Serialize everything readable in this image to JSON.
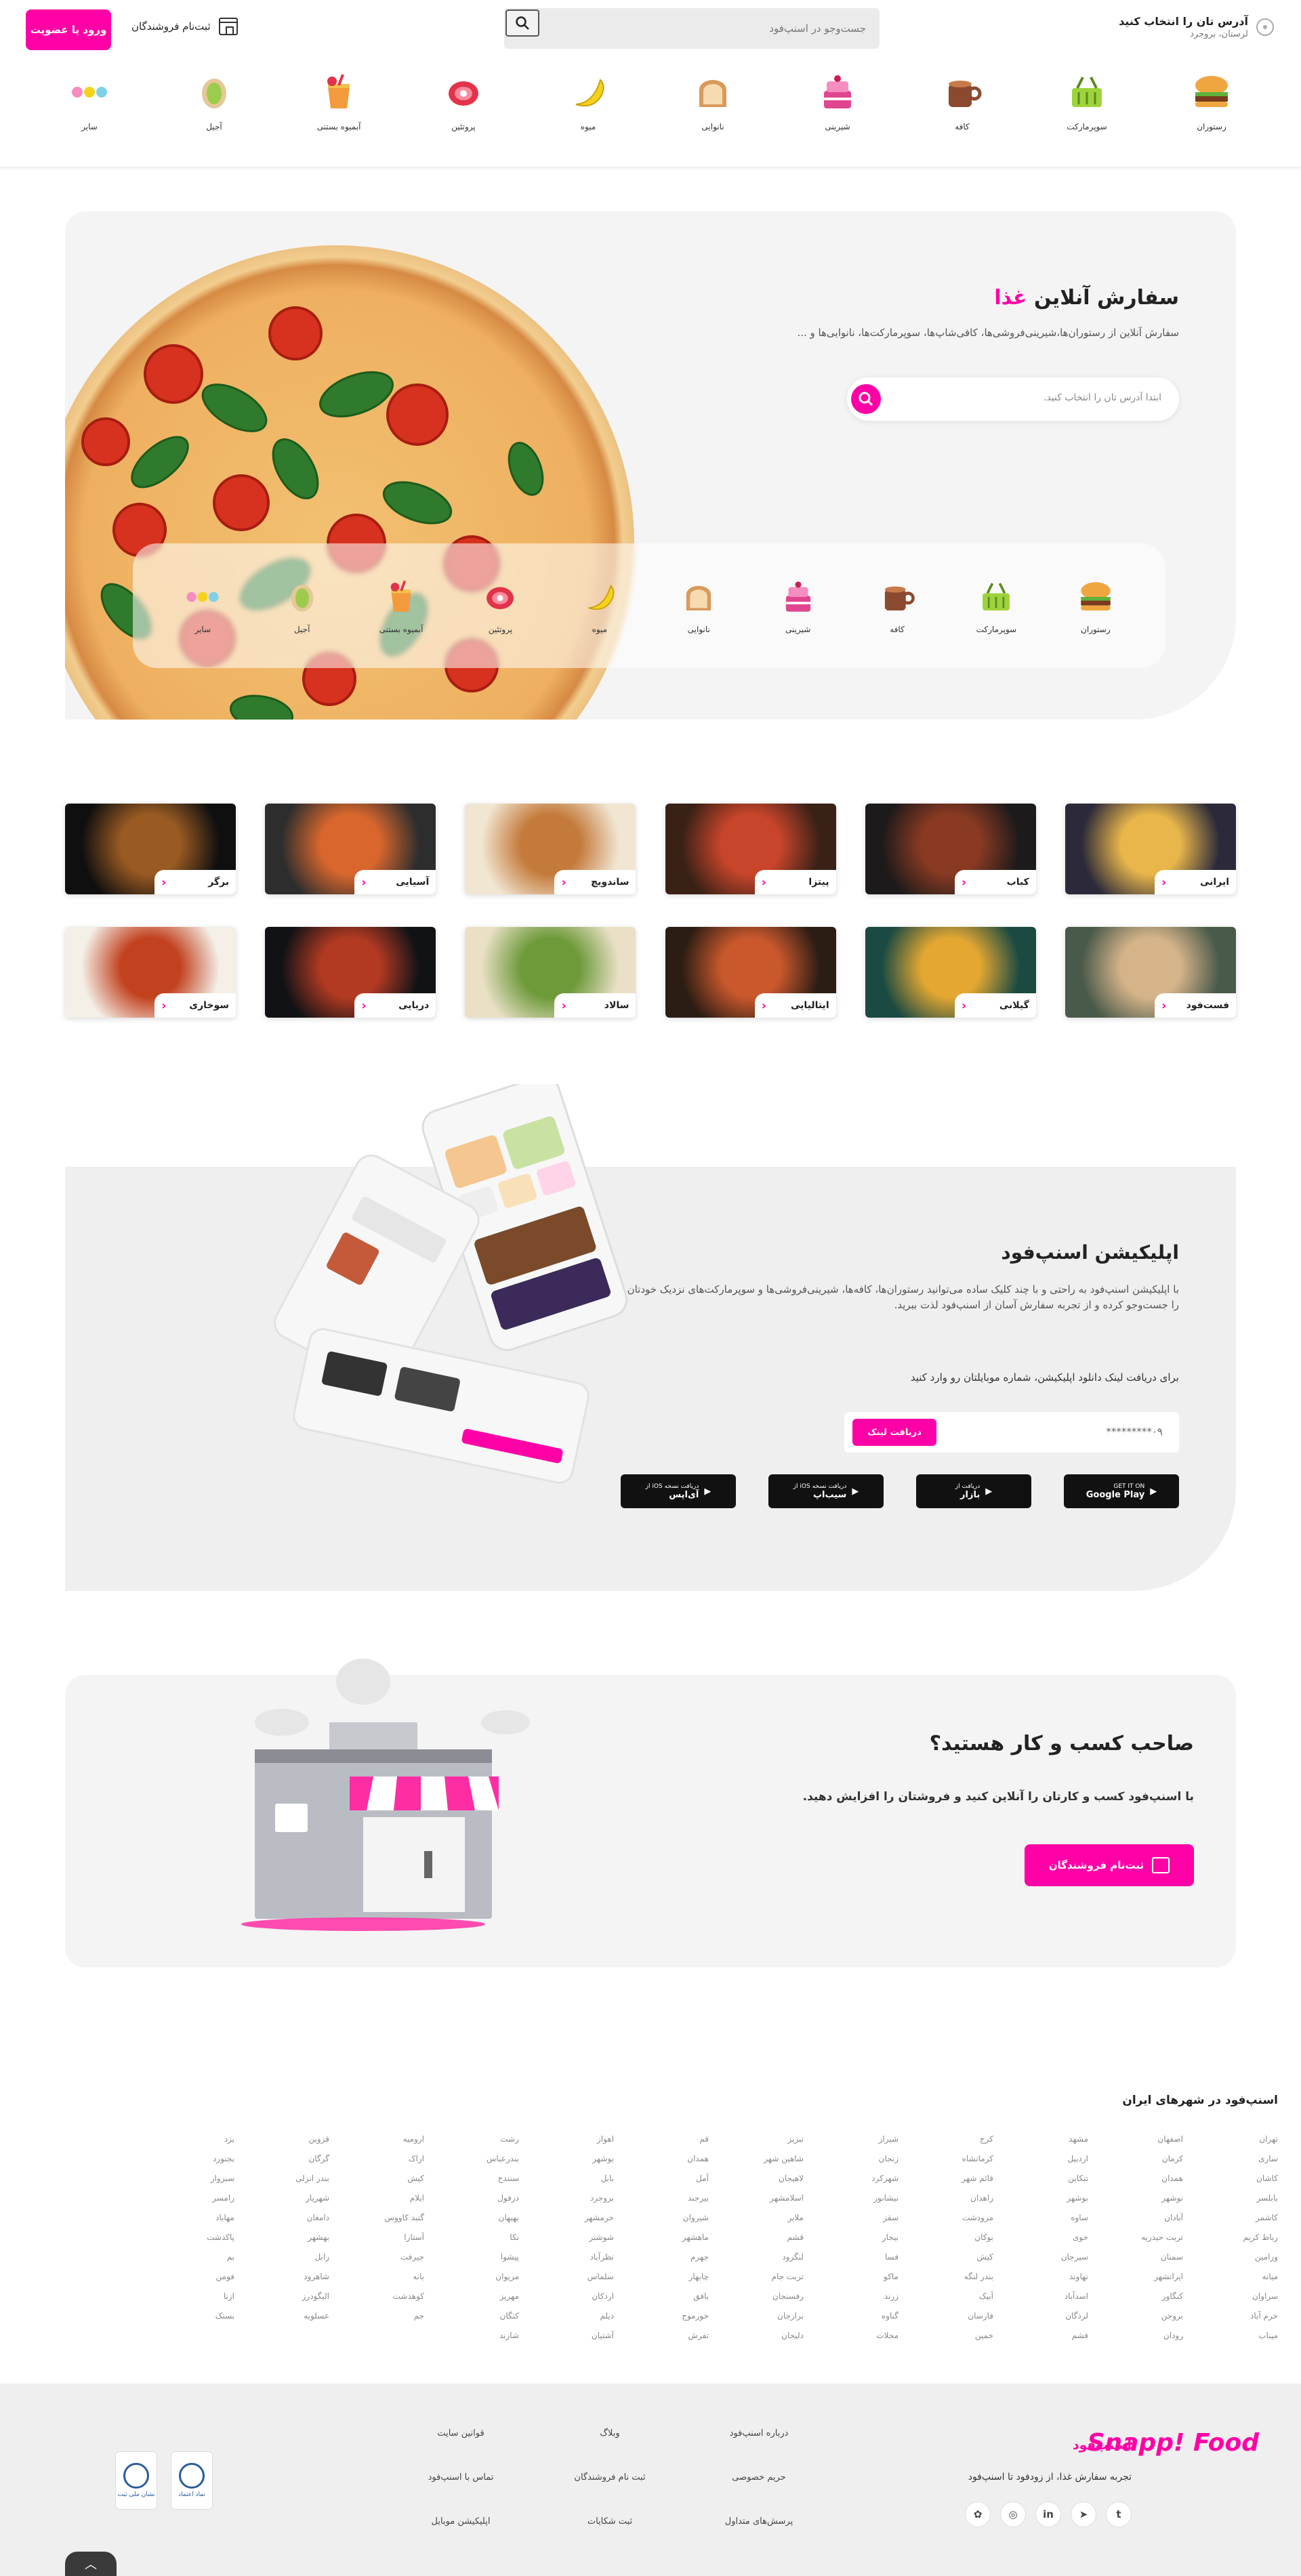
{
  "header": {
    "address_title": "آدرس تان را انتخاب کنید",
    "address_sub": "لرستان، بروجرد",
    "search_placeholder": "جست‌وجو در اسنپ‌فود",
    "login_label": "ورود یا عضویت",
    "vendor_register": "ثبت‌نام فروشندگان"
  },
  "categories": [
    {
      "label": "رستوران",
      "icon": "burger-icon"
    },
    {
      "label": "سوپرمارکت",
      "icon": "basket-icon"
    },
    {
      "label": "کافه",
      "icon": "coffee-cup-icon"
    },
    {
      "label": "شیرینی",
      "icon": "cake-icon"
    },
    {
      "label": "نانوایی",
      "icon": "bread-icon"
    },
    {
      "label": "میوه",
      "icon": "banana-icon"
    },
    {
      "label": "پروتئین",
      "icon": "meat-icon"
    },
    {
      "label": "آبمیوه بستنی",
      "icon": "juice-icon"
    },
    {
      "label": "آجیل",
      "icon": "pistachio-icon"
    },
    {
      "label": "سایر",
      "icon": "more-dots-icon"
    }
  ],
  "hero": {
    "title_prefix": "سفارش آنلاین",
    "title_accent": "غذا",
    "subtitle": "سفارش آنلاین از رستوران‌ها،شیرینی‌فروشی‌ها، کافی‌شاپ‌ها، سوپرمارکت‌ها، نانوایی‌ها و ...",
    "input_placeholder": "ابتدا آدرس تان را انتخاب کنید."
  },
  "food_rows": [
    [
      {
        "label": "ایرانی",
        "c1": "#e8b64b",
        "c2": "#2c2a3a"
      },
      {
        "label": "کباب",
        "c1": "#8a3a22",
        "c2": "#1c1a1a"
      },
      {
        "label": "پیتزا",
        "c1": "#c8452b",
        "c2": "#3a2116"
      },
      {
        "label": "ساندویچ",
        "c1": "#c47a3a",
        "c2": "#f1e6d2"
      },
      {
        "label": "آسیایی",
        "c1": "#d9672d",
        "c2": "#2d2d2d"
      },
      {
        "label": "برگر",
        "c1": "#9a5b22",
        "c2": "#0f0f0f"
      }
    ],
    [
      {
        "label": "فست‌فود",
        "c1": "#d6b48a",
        "c2": "#4a5a4a"
      },
      {
        "label": "گیلانی",
        "c1": "#e3a732",
        "c2": "#1b4a42"
      },
      {
        "label": "ایتالیایی",
        "c1": "#c9582c",
        "c2": "#2c1d14"
      },
      {
        "label": "سالاد",
        "c1": "#6e9a3a",
        "c2": "#e9e0c6"
      },
      {
        "label": "دریایی",
        "c1": "#b33a22",
        "c2": "#101216"
      },
      {
        "label": "سوخاری",
        "c1": "#c2411e",
        "c2": "#f4efe7"
      }
    ]
  ],
  "app": {
    "title": "اپلیکیشن اسنپ‌فود",
    "desc": "با اپلیکیشن اسنپ‌فود به راحتی و با چند کلیک ساده می‌توانید رستوران‌ها، کافه‌ها، شیرینی‌فروشی‌ها و سوپرمارکت‌های نزدیک خودتان را جست‌وجو کرده و از تجربه سفارش آسان از اسنپ‌فود لذت ببرید.",
    "prompt": "برای دریافت لینک دانلود اپلیکیشن، شماره موبایلتان رو وارد کنید",
    "phone_placeholder": "۰۹*********",
    "button": "دریافت لینک",
    "stores": [
      {
        "small": "GET IT ON",
        "big": "Google Play",
        "icon": "google-play-icon"
      },
      {
        "small": "دریافت از",
        "big": "بازار",
        "icon": "bazaar-icon"
      },
      {
        "small": "دریافت نسخه iOS از",
        "big": "سیب‌اپ",
        "icon": "apple-icon"
      },
      {
        "small": "دریافت نسخه iOS از",
        "big": "آی‌اپس",
        "icon": "iapps-icon"
      }
    ]
  },
  "business": {
    "title": "صاحب کسب و کار هستید؟",
    "desc": "با اسنپ‌فود کسب و کارتان را آنلاین کنید و فروشتان را افزایش دهید.",
    "button": "ثبت‌نام فروشندگان"
  },
  "cities_title": "اسنپ‌فود در شهرهای ایران",
  "cities": [
    "تهران",
    "اصفهان",
    "مشهد",
    "کرج",
    "شیراز",
    "تبریز",
    "قم",
    "اهواز",
    "رشت",
    "ارومیه",
    "قزوین",
    "یزد",
    "ساری",
    "کرمان",
    "اردبیل",
    "کرمانشاه",
    "زنجان",
    "شاهین شهر",
    "همدان",
    "بوشهر",
    "بندرعباس",
    "اراک",
    "گرگان",
    "بجنورد",
    "کاشان",
    "همدان",
    "تنکابن",
    "قائم شهر",
    "شهرکرد",
    "لاهیجان",
    "آمل",
    "بابل",
    "سنندج",
    "کیش",
    "بندر انزلی",
    "سبزوار",
    "بابلسر",
    "نوشهر",
    "بوشهر",
    "زاهدان",
    "نیشابور",
    "اسلامشهر",
    "بیرجند",
    "بروجرد",
    "دزفول",
    "ایلام",
    "شهریار",
    "رامسر",
    "کاشمر",
    "آبادان",
    "ساوه",
    "مرودشت",
    "سقز",
    "ملایر",
    "شیروان",
    "خرمشهر",
    "بهبهان",
    "گنبد کاووس",
    "دامغان",
    "مهاباد",
    "رباط کریم",
    "تربت حیدریه",
    "خوی",
    "بوکان",
    "بیجار",
    "قشم",
    "ماهشهر",
    "شوشتر",
    "نکا",
    "آستارا",
    "بهشهر",
    "پاکدشت",
    "ورامین",
    "سمنان",
    "سیرجان",
    "کیش",
    "فسا",
    "لنگرود",
    "جهرم",
    "نظرآباد",
    "پیشوا",
    "جیرفت",
    "زابل",
    "بم",
    "میانه",
    "ایرانشهر",
    "نهاوند",
    "بندر لنگه",
    "ماکو",
    "تربت جام",
    "چابهار",
    "سلماس",
    "مریوان",
    "بانه",
    "شاهرود",
    "فومن",
    "سراوان",
    "کنگاور",
    "اسدآباد",
    "آبیک",
    "زرند",
    "رفسنجان",
    "بافق",
    "اردکان",
    "مهریز",
    "کوهدشت",
    "الیگودرز",
    "ازنا",
    "خرم آباد",
    "بروجن",
    "لردگان",
    "فارسان",
    "گناوه",
    "برازجان",
    "خورموج",
    "دیلم",
    "کنگان",
    "جم",
    "عسلویه",
    "بستک",
    "میناب",
    "رودان",
    "قشم",
    "خمین",
    "محلات",
    "دلیجان",
    "تفرش",
    "آشتیان",
    "شازند"
  ],
  "footer": {
    "logo": "Snapp! Food",
    "name": "اسنپ‌فود",
    "tagline": "تجربه سفارش غذا، از زودفود تا اسنپ‌فود",
    "socials": [
      "twitter-icon",
      "telegram-icon",
      "linkedin-icon",
      "instagram-icon",
      "aparat-icon"
    ],
    "links": [
      "درباره اسنپ‌فود",
      "وبلاگ",
      "قوانین سایت",
      "حریم خصوصی",
      "ثبت نام فروشندگان",
      "تماس با اسنپ‌فود",
      "پرسش‌های متداول",
      "ثبت شکایات",
      "اپلیکیشن موبایل"
    ],
    "badges": [
      {
        "name": "enamad-badge",
        "text": "نماد اعتماد"
      },
      {
        "name": "samandehi-badge",
        "text": "نشان ملی ثبت"
      }
    ]
  },
  "colors": {
    "accent": "#ff00a6",
    "panel": "#f4f4f4"
  }
}
